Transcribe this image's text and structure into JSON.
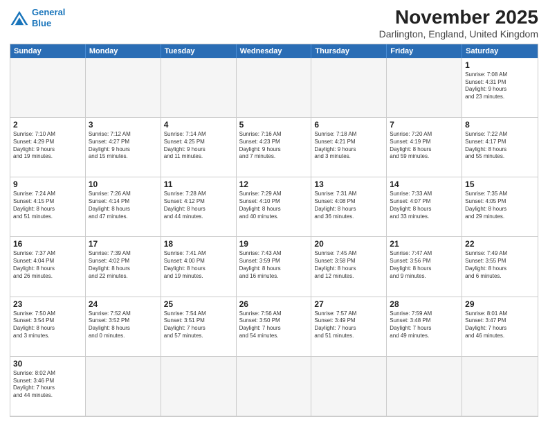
{
  "header": {
    "logo_line1": "General",
    "logo_line2": "Blue",
    "main_title": "November 2025",
    "subtitle": "Darlington, England, United Kingdom"
  },
  "calendar": {
    "days_of_week": [
      "Sunday",
      "Monday",
      "Tuesday",
      "Wednesday",
      "Thursday",
      "Friday",
      "Saturday"
    ],
    "weeks": [
      [
        {
          "day": "",
          "empty": true
        },
        {
          "day": "",
          "empty": true
        },
        {
          "day": "",
          "empty": true
        },
        {
          "day": "",
          "empty": true
        },
        {
          "day": "",
          "empty": true
        },
        {
          "day": "",
          "empty": true
        },
        {
          "day": "1",
          "info": "Sunrise: 7:08 AM\nSunset: 4:31 PM\nDaylight: 9 hours\nand 23 minutes."
        }
      ],
      [
        {
          "day": "2",
          "info": "Sunrise: 7:10 AM\nSunset: 4:29 PM\nDaylight: 9 hours\nand 19 minutes."
        },
        {
          "day": "3",
          "info": "Sunrise: 7:12 AM\nSunset: 4:27 PM\nDaylight: 9 hours\nand 15 minutes."
        },
        {
          "day": "4",
          "info": "Sunrise: 7:14 AM\nSunset: 4:25 PM\nDaylight: 9 hours\nand 11 minutes."
        },
        {
          "day": "5",
          "info": "Sunrise: 7:16 AM\nSunset: 4:23 PM\nDaylight: 9 hours\nand 7 minutes."
        },
        {
          "day": "6",
          "info": "Sunrise: 7:18 AM\nSunset: 4:21 PM\nDaylight: 9 hours\nand 3 minutes."
        },
        {
          "day": "7",
          "info": "Sunrise: 7:20 AM\nSunset: 4:19 PM\nDaylight: 8 hours\nand 59 minutes."
        },
        {
          "day": "8",
          "info": "Sunrise: 7:22 AM\nSunset: 4:17 PM\nDaylight: 8 hours\nand 55 minutes."
        }
      ],
      [
        {
          "day": "9",
          "info": "Sunrise: 7:24 AM\nSunset: 4:15 PM\nDaylight: 8 hours\nand 51 minutes."
        },
        {
          "day": "10",
          "info": "Sunrise: 7:26 AM\nSunset: 4:14 PM\nDaylight: 8 hours\nand 47 minutes."
        },
        {
          "day": "11",
          "info": "Sunrise: 7:28 AM\nSunset: 4:12 PM\nDaylight: 8 hours\nand 44 minutes."
        },
        {
          "day": "12",
          "info": "Sunrise: 7:29 AM\nSunset: 4:10 PM\nDaylight: 8 hours\nand 40 minutes."
        },
        {
          "day": "13",
          "info": "Sunrise: 7:31 AM\nSunset: 4:08 PM\nDaylight: 8 hours\nand 36 minutes."
        },
        {
          "day": "14",
          "info": "Sunrise: 7:33 AM\nSunset: 4:07 PM\nDaylight: 8 hours\nand 33 minutes."
        },
        {
          "day": "15",
          "info": "Sunrise: 7:35 AM\nSunset: 4:05 PM\nDaylight: 8 hours\nand 29 minutes."
        }
      ],
      [
        {
          "day": "16",
          "info": "Sunrise: 7:37 AM\nSunset: 4:04 PM\nDaylight: 8 hours\nand 26 minutes."
        },
        {
          "day": "17",
          "info": "Sunrise: 7:39 AM\nSunset: 4:02 PM\nDaylight: 8 hours\nand 22 minutes."
        },
        {
          "day": "18",
          "info": "Sunrise: 7:41 AM\nSunset: 4:00 PM\nDaylight: 8 hours\nand 19 minutes."
        },
        {
          "day": "19",
          "info": "Sunrise: 7:43 AM\nSunset: 3:59 PM\nDaylight: 8 hours\nand 16 minutes."
        },
        {
          "day": "20",
          "info": "Sunrise: 7:45 AM\nSunset: 3:58 PM\nDaylight: 8 hours\nand 12 minutes."
        },
        {
          "day": "21",
          "info": "Sunrise: 7:47 AM\nSunset: 3:56 PM\nDaylight: 8 hours\nand 9 minutes."
        },
        {
          "day": "22",
          "info": "Sunrise: 7:49 AM\nSunset: 3:55 PM\nDaylight: 8 hours\nand 6 minutes."
        }
      ],
      [
        {
          "day": "23",
          "info": "Sunrise: 7:50 AM\nSunset: 3:54 PM\nDaylight: 8 hours\nand 3 minutes."
        },
        {
          "day": "24",
          "info": "Sunrise: 7:52 AM\nSunset: 3:52 PM\nDaylight: 8 hours\nand 0 minutes."
        },
        {
          "day": "25",
          "info": "Sunrise: 7:54 AM\nSunset: 3:51 PM\nDaylight: 7 hours\nand 57 minutes."
        },
        {
          "day": "26",
          "info": "Sunrise: 7:56 AM\nSunset: 3:50 PM\nDaylight: 7 hours\nand 54 minutes."
        },
        {
          "day": "27",
          "info": "Sunrise: 7:57 AM\nSunset: 3:49 PM\nDaylight: 7 hours\nand 51 minutes."
        },
        {
          "day": "28",
          "info": "Sunrise: 7:59 AM\nSunset: 3:48 PM\nDaylight: 7 hours\nand 49 minutes."
        },
        {
          "day": "29",
          "info": "Sunrise: 8:01 AM\nSunset: 3:47 PM\nDaylight: 7 hours\nand 46 minutes."
        }
      ],
      [
        {
          "day": "30",
          "info": "Sunrise: 8:02 AM\nSunset: 3:46 PM\nDaylight: 7 hours\nand 44 minutes."
        },
        {
          "day": "",
          "empty": true
        },
        {
          "day": "",
          "empty": true
        },
        {
          "day": "",
          "empty": true
        },
        {
          "day": "",
          "empty": true
        },
        {
          "day": "",
          "empty": true
        },
        {
          "day": "",
          "empty": true
        }
      ]
    ]
  }
}
